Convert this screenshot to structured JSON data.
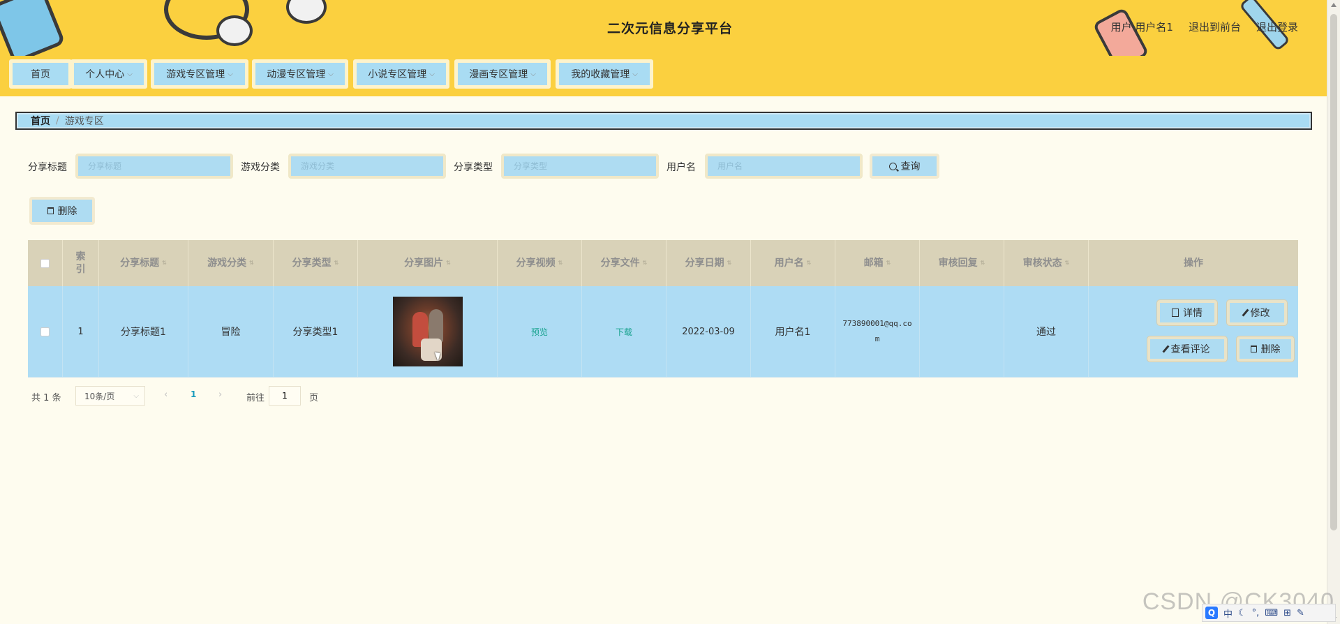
{
  "header": {
    "title": "二次元信息分享平台",
    "user_label": "用户",
    "username": "用户名1",
    "to_frontend": "退出到前台",
    "logout": "退出登录"
  },
  "nav": {
    "items": [
      {
        "label": "首页",
        "has_dropdown": false
      },
      {
        "label": "个人中心",
        "has_dropdown": true
      },
      {
        "label": "游戏专区管理",
        "has_dropdown": true
      },
      {
        "label": "动漫专区管理",
        "has_dropdown": true
      },
      {
        "label": "小说专区管理",
        "has_dropdown": true
      },
      {
        "label": "漫画专区管理",
        "has_dropdown": true
      },
      {
        "label": "我的收藏管理",
        "has_dropdown": true
      }
    ]
  },
  "breadcrumb": {
    "home": "首页",
    "current": "游戏专区"
  },
  "search": {
    "fields": [
      {
        "label": "分享标题",
        "placeholder": "分享标题"
      },
      {
        "label": "游戏分类",
        "placeholder": "游戏分类"
      },
      {
        "label": "分享类型",
        "placeholder": "分享类型"
      },
      {
        "label": "用户名",
        "placeholder": "用户名"
      }
    ],
    "query_button": "查询"
  },
  "toolbar": {
    "delete_button": "删除"
  },
  "table": {
    "columns": [
      "索引",
      "分享标题",
      "游戏分类",
      "分享类型",
      "分享图片",
      "分享视频",
      "分享文件",
      "分享日期",
      "用户名",
      "邮箱",
      "审核回复",
      "审核状态",
      "操作"
    ],
    "rows": [
      {
        "index": "1",
        "title": "分享标题1",
        "game_category": "冒险",
        "share_type": "分享类型1",
        "video_link": "预览",
        "file_link": "下载",
        "date": "2022-03-09",
        "username": "用户名1",
        "email": "773890001@qq.com",
        "review_reply": "",
        "review_status": "通过",
        "actions": {
          "detail": "详情",
          "edit": "修改",
          "view_comments": "查看评论",
          "delete": "删除"
        }
      }
    ]
  },
  "pagination": {
    "total_prefix": "共",
    "total_count": "1",
    "total_suffix": "条",
    "page_size": "10条/页",
    "current_page": "1",
    "goto_label": "前往",
    "goto_value": "1",
    "page_label": "页"
  },
  "watermark": "CSDN @CK3040",
  "ime": {
    "mode": "中",
    "logo": "Q"
  },
  "colors": {
    "header_bg": "#fbd03f",
    "page_bg": "#fefcef",
    "accent_blue": "#aedcf2",
    "table_header_bg": "#d9d2b8",
    "link_green": "#18a28e"
  },
  "icons": {
    "query": "search-icon",
    "delete": "trash-icon",
    "detail": "document-icon",
    "edit": "edit-icon"
  }
}
